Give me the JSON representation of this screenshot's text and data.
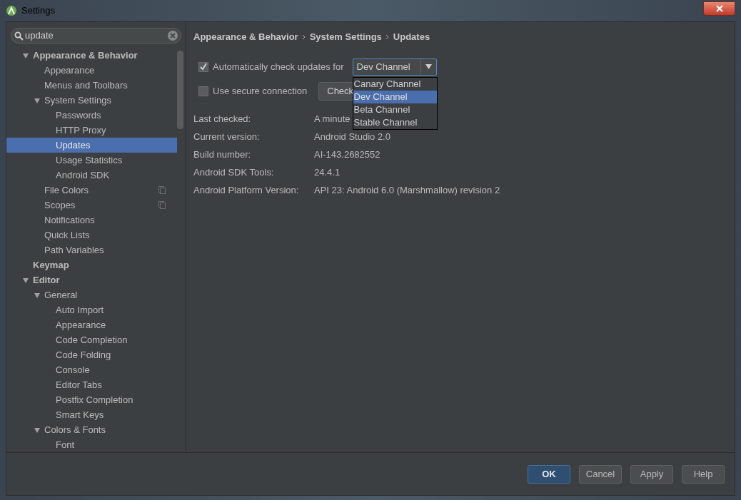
{
  "window": {
    "title": "Settings"
  },
  "search": {
    "value": "update"
  },
  "tree": [
    {
      "label": "Appearance & Behavior",
      "selected": false,
      "expanded": true,
      "per_project": false,
      "children": [
        {
          "label": "Appearance",
          "selected": false,
          "per_project": false
        },
        {
          "label": "Menus and Toolbars",
          "selected": false,
          "per_project": false
        },
        {
          "label": "System Settings",
          "selected": false,
          "expanded": true,
          "per_project": false,
          "children": [
            {
              "label": "Passwords",
              "selected": false,
              "per_project": false
            },
            {
              "label": "HTTP Proxy",
              "selected": false,
              "per_project": false
            },
            {
              "label": "Updates",
              "selected": true,
              "per_project": false
            },
            {
              "label": "Usage Statistics",
              "selected": false,
              "per_project": false
            },
            {
              "label": "Android SDK",
              "selected": false,
              "per_project": false
            }
          ]
        },
        {
          "label": "File Colors",
          "selected": false,
          "per_project": true
        },
        {
          "label": "Scopes",
          "selected": false,
          "per_project": true
        },
        {
          "label": "Notifications",
          "selected": false,
          "per_project": false
        },
        {
          "label": "Quick Lists",
          "selected": false,
          "per_project": false
        },
        {
          "label": "Path Variables",
          "selected": false,
          "per_project": false
        }
      ]
    },
    {
      "label": "Keymap",
      "selected": false,
      "per_project": false
    },
    {
      "label": "Editor",
      "selected": false,
      "expanded": true,
      "per_project": false,
      "children": [
        {
          "label": "General",
          "selected": false,
          "expanded": true,
          "per_project": false,
          "children": [
            {
              "label": "Auto Import",
              "selected": false,
              "per_project": false
            },
            {
              "label": "Appearance",
              "selected": false,
              "per_project": false
            },
            {
              "label": "Code Completion",
              "selected": false,
              "per_project": false
            },
            {
              "label": "Code Folding",
              "selected": false,
              "per_project": false
            },
            {
              "label": "Console",
              "selected": false,
              "per_project": false
            },
            {
              "label": "Editor Tabs",
              "selected": false,
              "per_project": false
            },
            {
              "label": "Postfix Completion",
              "selected": false,
              "per_project": false
            },
            {
              "label": "Smart Keys",
              "selected": false,
              "per_project": false
            }
          ]
        },
        {
          "label": "Colors & Fonts",
          "selected": false,
          "expanded": true,
          "per_project": false,
          "children": [
            {
              "label": "Font",
              "selected": false,
              "per_project": false
            }
          ]
        }
      ]
    }
  ],
  "breadcrumb": [
    "Appearance & Behavior",
    "System Settings",
    "Updates"
  ],
  "auto_check": {
    "label": "Automatically check updates for",
    "checked": true,
    "channel": "Dev Channel"
  },
  "channel_options": [
    {
      "label": "Canary Channel",
      "selected": false
    },
    {
      "label": "Dev Channel",
      "selected": true
    },
    {
      "label": "Beta Channel",
      "selected": false
    },
    {
      "label": "Stable Channel",
      "selected": false
    }
  ],
  "secure": {
    "label": "Use secure connection",
    "checked": false
  },
  "check_button": "Check",
  "info": [
    {
      "label": "Last checked:",
      "value": "A minute"
    },
    {
      "label": "Current version:",
      "value": "Android Studio 2.0"
    },
    {
      "label": "Build number:",
      "value": "AI-143.2682552"
    },
    {
      "label": "Android SDK Tools:",
      "value": "24.4.1"
    },
    {
      "label": "Android Platform Version:",
      "value": "API 23: Android 6.0 (Marshmallow) revision 2"
    }
  ],
  "buttons": [
    {
      "label": "OK",
      "kind": "default"
    },
    {
      "label": "Cancel",
      "kind": "normal"
    },
    {
      "label": "Apply",
      "kind": "normal"
    },
    {
      "label": "Help",
      "kind": "normal"
    }
  ]
}
